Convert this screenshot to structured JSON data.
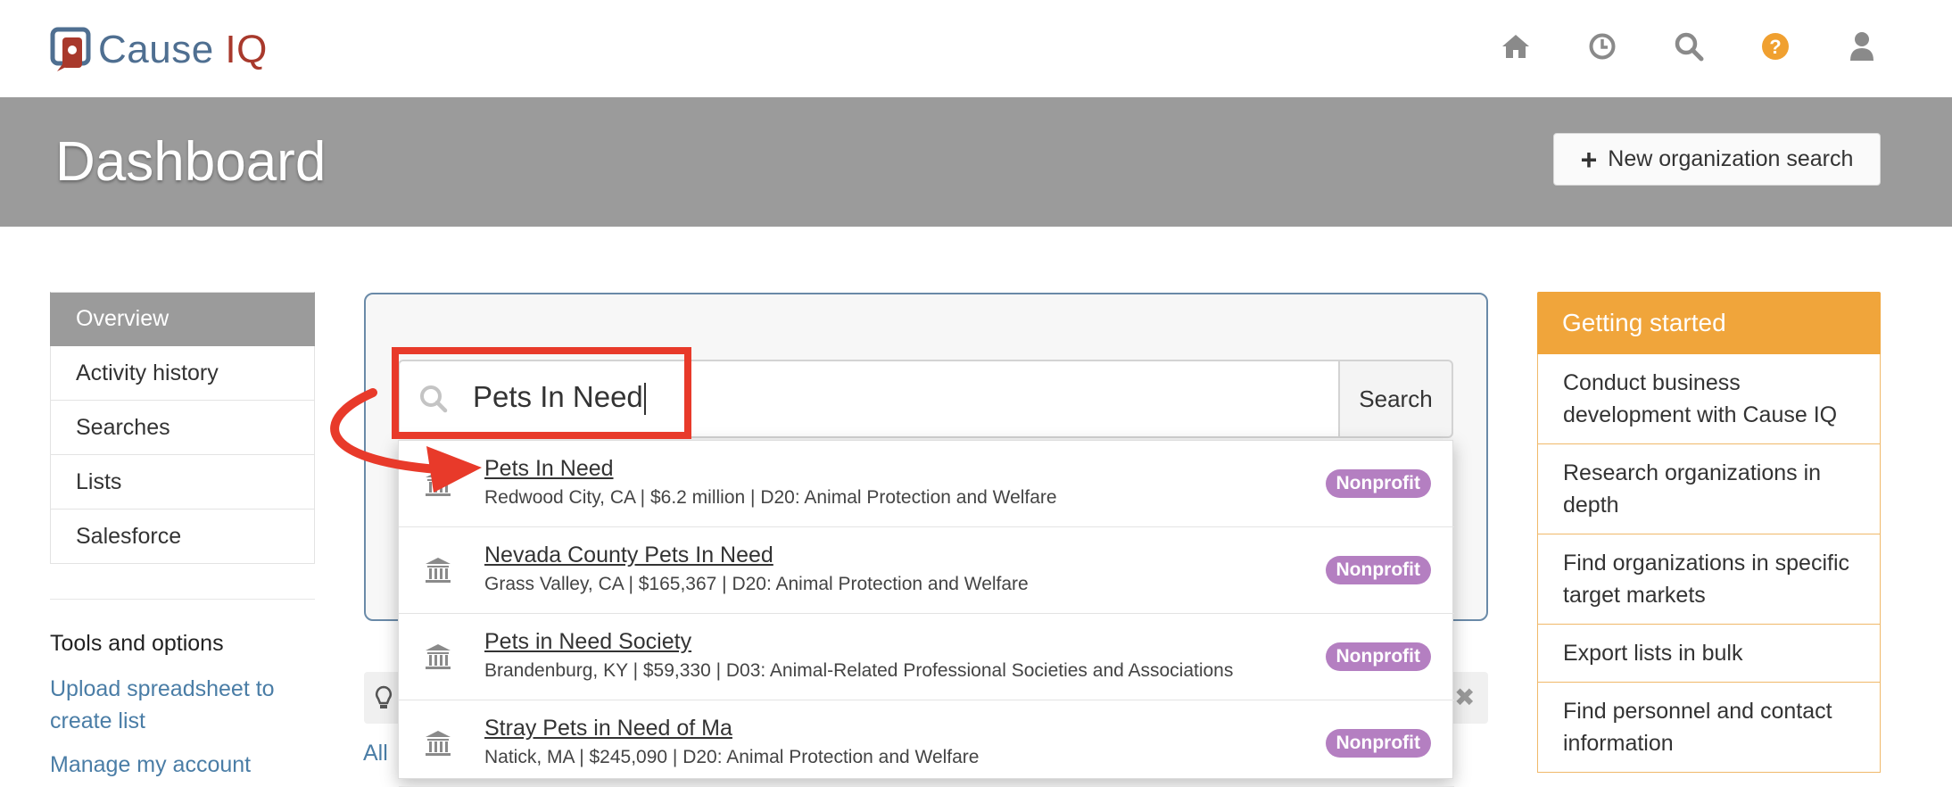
{
  "app": {
    "logo_part1": "Cause ",
    "logo_part2": "IQ",
    "brand_color": "#a8392c",
    "accent_color": "#4f6f91"
  },
  "nav_icons": [
    "home-icon",
    "history-icon",
    "search-icon",
    "help-icon",
    "user-icon"
  ],
  "header": {
    "title": "Dashboard",
    "new_search_label": "New organization search",
    "new_search_icon": "+"
  },
  "sidebar": {
    "items": [
      {
        "label": "Overview",
        "active": true
      },
      {
        "label": "Activity history",
        "active": false
      },
      {
        "label": "Searches",
        "active": false
      },
      {
        "label": "Lists",
        "active": false
      },
      {
        "label": "Salesforce",
        "active": false
      }
    ],
    "tools_title": "Tools and options",
    "tools_links": [
      "Upload spreadsheet to create list",
      "Manage my account"
    ]
  },
  "search": {
    "value": "Pets In Need",
    "button_label": "Search"
  },
  "results": [
    {
      "name": "Pets In Need",
      "meta": "Redwood City, CA | $6.2 million | D20: Animal Protection and Welfare",
      "badge": "Nonprofit"
    },
    {
      "name": "Nevada County Pets In Need",
      "meta": "Grass Valley, CA | $165,367 | D20: Animal Protection and Welfare",
      "badge": "Nonprofit"
    },
    {
      "name": "Pets in Need Society",
      "meta": "Brandenburg, KY | $59,330 | D03: Animal-Related Professional Societies and Associations",
      "badge": "Nonprofit"
    },
    {
      "name": "Stray Pets in Need of Ma",
      "meta": "Natick, MA | $245,090 | D20: Animal Protection and Welfare",
      "badge": "Nonprofit"
    }
  ],
  "tip": {
    "bulb_icon": "lightbulb-icon",
    "close": "✖"
  },
  "all_link": "All",
  "getting_started": {
    "title": "Getting started",
    "items": [
      "Conduct business development with Cause IQ",
      "Research organizations in depth",
      "Find organizations in specific target markets",
      "Export lists in bulk",
      "Find personnel and contact information"
    ]
  },
  "colors": {
    "header_band": "#9b9b9b",
    "highlight": "#e83a2a",
    "badge": "#b47fc1",
    "getting_started": "#f0a53b"
  }
}
